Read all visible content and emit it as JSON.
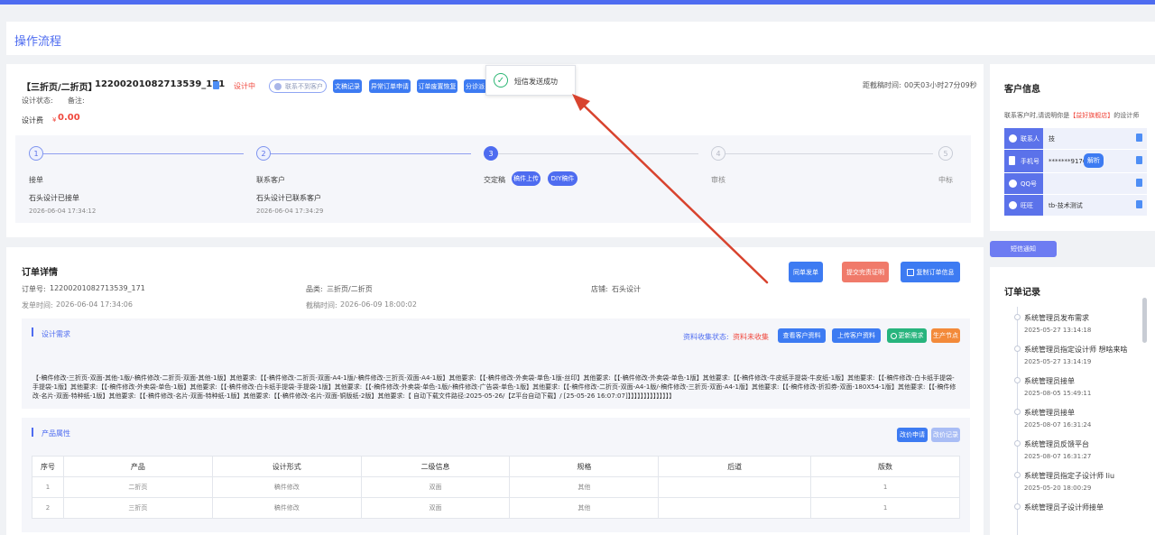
{
  "colors": {
    "accent": "#4e6cf0",
    "danger": "#f0473c",
    "success": "#2bb673"
  },
  "page": {
    "title": "操作流程"
  },
  "order_top": {
    "type_label": "【三折页/二折页】",
    "order_id": "12200201082713539_171",
    "status": "设计中",
    "contact_unreachable": "联系不到客户",
    "btn_manuscript_record": "文稿记录",
    "btn_abnormal_order": "异常订单申请",
    "btn_order_restore": "订单废置恢复",
    "btn_split": "分诊派",
    "design_status_label": "设计状态:",
    "remark_label": "备注:",
    "design_fee_label": "设计费",
    "fee_currency": "¥",
    "fee_value": "0.00",
    "deadline_label": "距截稿时间:",
    "deadline_value": "00天03小时27分09秒"
  },
  "steps": [
    {
      "num": "1",
      "name": "接单",
      "desc": "石头设计已接单",
      "time": "2026-06-04 17:34:12",
      "state": "done"
    },
    {
      "num": "2",
      "name": "联系客户",
      "desc": "石头设计已联系客户",
      "time": "2026-06-04 17:34:29",
      "state": "done"
    },
    {
      "num": "3",
      "name": "交定稿",
      "desc": "",
      "time": "",
      "state": "active"
    },
    {
      "num": "4",
      "name": "审核",
      "desc": "",
      "time": "",
      "state": "todo"
    },
    {
      "num": "5",
      "name": "中标",
      "desc": "",
      "time": "",
      "state": "todo"
    }
  ],
  "step3_buttons": {
    "upload": "稿件上传",
    "diy": "DIY稿件"
  },
  "toast": {
    "message": "短信发送成功",
    "icon": "check-circle-icon"
  },
  "order_detail": {
    "title": "订单详情",
    "order_no_label": "订单号:",
    "order_no": "12200201082713539_171",
    "category_label": "品类:",
    "category": "三折页/二折页",
    "shop_label": "店铺:",
    "shop": "石头设计",
    "send_time_label": "发单时间:",
    "send_time": "2026-06-04 17:34:06",
    "deadline_label": "截稿时间:",
    "deadline": "2026-06-09 18:00:02",
    "btn_resend": "同单发单",
    "btn_submit_proof": "提交完责证明",
    "btn_copy": "复制订单信息"
  },
  "design_req": {
    "title": "设计需求",
    "collect_label": "资料收集状态:",
    "collect_value": "资料未收集",
    "btn_view": "查看客户资料",
    "btn_upload": "上传客户资料",
    "btn_update": "更新需求",
    "btn_production": "生产节点",
    "text": "【-稿件修改-三折页-双面-其他-1版/-稿件修改-二折页-双面-其他-1版】其他要求:【【-稿件修改-二折页-双面-A4-1版/-稿件修改-三折页-双面-A4-1版】其他要求:【【-稿件修改-外卖袋-单色-1版-丝印】其他要求:【【-稿件修改-外卖袋-单色-1版】其他要求:【【-稿件修改-牛皮纸手提袋-牛皮纸-1版】其他要求:【【-稿件修改-白卡纸手提袋-手提袋-1版】其他要求:【【-稿件修改-外卖袋-单色-1版】其他要求:【【-稿件修改-白卡纸手提袋-手提袋-1版】其他要求:【【-稿件修改-外卖袋-单色-1版/-稿件修改-广告袋-单色-1版】其他要求:【【-稿件修改-二折页-双面-A4-1版/-稿件修改-三折页-双面-A4-1版】其他要求:【【-稿件修改-折扣券-双面-180X54-1版】其他要求:【【-稿件修改-名片-双面-特种纸-1版】其他要求:【【-稿件修改-名片-双面-特种纸-1版】其他要求:【【-稿件修改-名片-双面-铜版纸-2版】其他要求:【 自动下载文件路径:2025-05-26/【Z平台自动下载】/ [25-05-26 16:07:07]】】】】】】】】】】】】】】"
  },
  "product_attr": {
    "title": "产品属性",
    "btn_change_price": "改价申请",
    "btn_change_record": "改价记录",
    "headers": [
      "序号",
      "产品",
      "设计形式",
      "二级信息",
      "规格",
      "后道",
      "版数"
    ],
    "rows": [
      [
        "1",
        "二折页",
        "稿件修改",
        "双面",
        "其他",
        "",
        "1"
      ],
      [
        "2",
        "三折页",
        "稿件修改",
        "双面",
        "其他",
        "",
        "1"
      ]
    ]
  },
  "customer": {
    "title": "客户信息",
    "tip_prefix": "联系客户时,请说明你是",
    "tip_shop": "【益好旗舰店】",
    "tip_suffix": "的设计师",
    "rows": [
      {
        "label": "联系人",
        "value": "技",
        "icon": "user-icon"
      },
      {
        "label": "手机号",
        "value": "*******9170",
        "icon": "phone-icon"
      },
      {
        "label": "QQ号",
        "value": "",
        "icon": "qq-icon"
      },
      {
        "label": "旺旺",
        "value": "tb-技术测试",
        "icon": "wangwang-icon"
      }
    ],
    "btn_parse": "解析",
    "btn_sms": "短信通知"
  },
  "records": {
    "title": "订单记录",
    "items": [
      {
        "title": "系统管理员发布需求",
        "time": "2025-05-27 13:14:18"
      },
      {
        "title": "系统管理员指定设计师 想啥来啥",
        "time": "2025-05-27 13:14:19"
      },
      {
        "title": "系统管理员接单",
        "time": "2025-08-05 15:49:11"
      },
      {
        "title": "系统管理员接单",
        "time": "2025-08-07 16:31:24"
      },
      {
        "title": "系统管理员反馈平台",
        "time": "2025-08-07 16:31:27"
      },
      {
        "title": "系统管理员指定子设计师 liu",
        "time": "2025-05-20 18:00:29"
      },
      {
        "title": "系统管理员子设计师接单",
        "time": ""
      }
    ]
  }
}
